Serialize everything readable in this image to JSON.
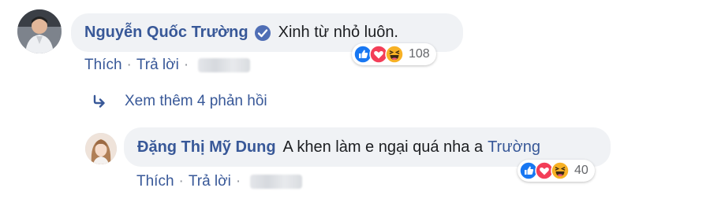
{
  "comment1": {
    "author": "Nguyễn Quốc Trường",
    "text": "Xinh từ nhỏ luôn.",
    "reaction_count": "108",
    "actions": {
      "like": "Thích",
      "reply": "Trả lời",
      "sep": "·"
    },
    "verified_icon": "verified-check-icon",
    "reaction_icons": [
      "like-icon",
      "love-icon",
      "haha-icon"
    ]
  },
  "view_more": {
    "label": "Xem thêm 4 phản hồi",
    "icon": "reply-arrow-icon"
  },
  "comment2": {
    "author": "Đặng Thị Mỹ Dung",
    "text_before_mention": "A khen làm e ngại quá nha a",
    "mention": "Trường",
    "reaction_count": "40",
    "actions": {
      "like": "Thích",
      "reply": "Trả lời",
      "sep": "·"
    },
    "reaction_icons": [
      "like-icon",
      "love-icon",
      "haha-icon"
    ]
  },
  "colors": {
    "link": "#385898",
    "bubble": "#f0f2f5",
    "like": "#1877f2",
    "love": "#f33e58",
    "haha": "#f7b125",
    "text": "#1c1e21",
    "meta": "#65676b"
  }
}
